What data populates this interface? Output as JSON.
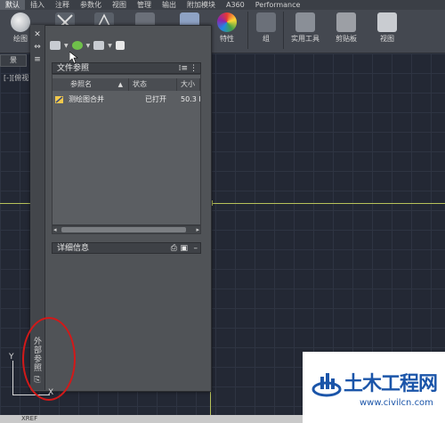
{
  "ribbon_tabs": [
    "默认",
    "插入",
    "注释",
    "参数化",
    "视图",
    "管理",
    "输出",
    "附加模块",
    "A360",
    "Performance"
  ],
  "ribbon_buttons": {
    "draw": "绘图",
    "properties": "特性",
    "groups": "组",
    "utilities": "实用工具",
    "clipboard": "剪贴板",
    "view": "视图"
  },
  "file_tab": "景",
  "viewport_label": "[-][俯视",
  "palette": {
    "vertical_title": "外部参照",
    "file_refs_header": "文件参照",
    "columns": [
      "参照名",
      "状态",
      "大小"
    ],
    "rows": [
      {
        "name": "测绘图合并",
        "status": "已打开",
        "size": "50.3 I"
      }
    ],
    "details_header": "详细信息"
  },
  "ucs": {
    "x": "X",
    "y": "Y"
  },
  "command_line": "XREF",
  "watermark": {
    "title": "土木工程网",
    "url": "www.civilcn.com"
  },
  "colors": {
    "grid_line": "#b8c25a",
    "annotation": "#d21919",
    "brand": "#1b55a9"
  }
}
